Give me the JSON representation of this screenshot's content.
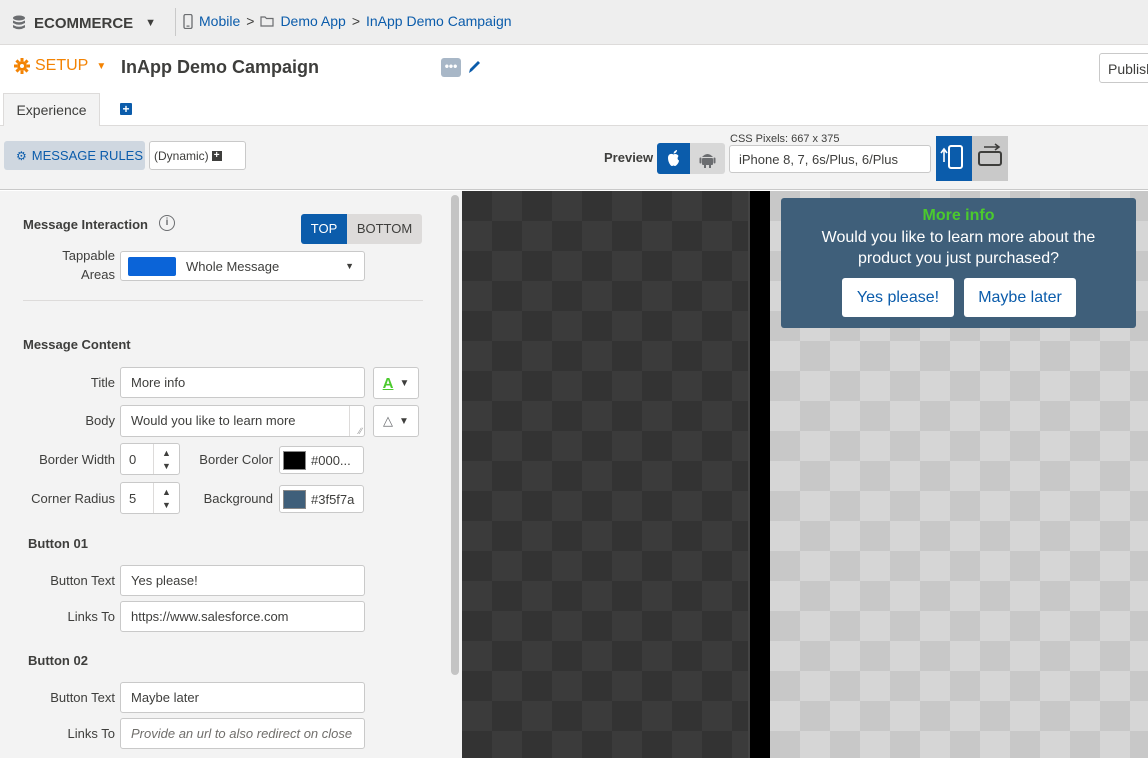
{
  "topbar": {
    "app_name": "ECOMMERCE",
    "breadcrumbs": [
      "Mobile",
      "Demo App",
      "InApp Demo Campaign"
    ]
  },
  "titlebar": {
    "setup_label": "SETUP",
    "campaign_title": "InApp Demo Campaign",
    "more_label": "•••",
    "publish_label": "Publish"
  },
  "tabs": [
    {
      "label": "Experience"
    }
  ],
  "rules": {
    "message_rules_label": "MESSAGE RULES",
    "dynamic_label": "(Dynamic)",
    "preview_label": "Preview",
    "css_pixels": "CSS Pixels: 667 x 375",
    "device": "iPhone 8, 7, 6s/Plus, 6/Plus"
  },
  "panel": {
    "interaction_heading": "Message Interaction",
    "position_options": [
      "TOP",
      "BOTTOM"
    ],
    "position_selected": "TOP",
    "tappable_label_line1": "Tappable",
    "tappable_label_line2": "Areas",
    "tappable_value": "Whole Message",
    "tappable_color": "#0b64d8",
    "content_heading": "Message Content",
    "title_label": "Title",
    "title_value": "More info",
    "body_label": "Body",
    "body_value": "Would you like to learn more",
    "border_width_label": "Border Width",
    "border_width_value": "0",
    "border_color_label": "Border Color",
    "border_color_value": "#000...",
    "border_color_swatch": "#000000",
    "corner_radius_label": "Corner Radius",
    "corner_radius_value": "5",
    "background_label": "Background",
    "background_value": "#3f5f7a",
    "background_swatch": "#3f5f7a",
    "button1_heading": "Button 01",
    "button1_text_label": "Button Text",
    "button1_text_value": "Yes please!",
    "button1_link_label": "Links To",
    "button1_link_value": "https://www.salesforce.com",
    "button2_heading": "Button 02",
    "button2_text_label": "Button Text",
    "button2_text_value": "Maybe later",
    "button2_link_label": "Links To",
    "button2_link_placeholder": "Provide an url to also redirect on close"
  },
  "preview": {
    "title": "More info",
    "title_color": "#4bca2d",
    "body": "Would you like to learn more about the product you just purchased?",
    "button1": "Yes please!",
    "button2": "Maybe later",
    "background": "#3f5f7a"
  }
}
